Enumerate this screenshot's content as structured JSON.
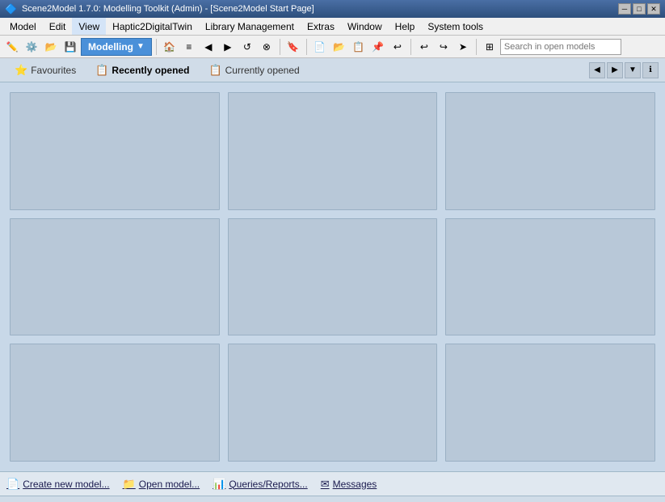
{
  "window": {
    "title": "Scene2Model 1.7.0: Modelling Toolkit (Admin) - [Scene2Model Start Page]",
    "icon": "🔷"
  },
  "title_bar_buttons": {
    "minimize": "─",
    "restore": "□",
    "close": "✕"
  },
  "menu_bar": {
    "items": [
      {
        "label": "Model",
        "id": "model"
      },
      {
        "label": "Edit",
        "id": "edit"
      },
      {
        "label": "View",
        "id": "view"
      },
      {
        "label": "Haptic2DigitalTwin",
        "id": "haptic"
      },
      {
        "label": "Library Management",
        "id": "library"
      },
      {
        "label": "Extras",
        "id": "extras"
      },
      {
        "label": "Window",
        "id": "window"
      },
      {
        "label": "Help",
        "id": "help"
      },
      {
        "label": "System tools",
        "id": "system"
      }
    ]
  },
  "toolbar": {
    "dropdown_label": "Modelling",
    "search_placeholder": "Search in open models"
  },
  "tabs": {
    "items": [
      {
        "label": "Favourites",
        "icon": "⭐",
        "id": "favourites",
        "active": false
      },
      {
        "label": "Recently opened",
        "icon": "📋",
        "id": "recently",
        "active": true
      },
      {
        "label": "Currently opened",
        "icon": "📋",
        "id": "currently",
        "active": false
      }
    ]
  },
  "grid": {
    "cells": [
      {
        "id": 1
      },
      {
        "id": 2
      },
      {
        "id": 3
      },
      {
        "id": 4
      },
      {
        "id": 5
      },
      {
        "id": 6
      },
      {
        "id": 7
      },
      {
        "id": 8
      },
      {
        "id": 9
      }
    ]
  },
  "status_bar": {
    "items": [
      {
        "label": "Create new model...",
        "icon": "📄",
        "id": "create-new"
      },
      {
        "label": "Open model...",
        "icon": "📁",
        "id": "open-model"
      },
      {
        "label": "Queries/Reports...",
        "icon": "📊",
        "id": "queries"
      },
      {
        "label": "Messages",
        "icon": "✉",
        "id": "messages"
      }
    ]
  }
}
